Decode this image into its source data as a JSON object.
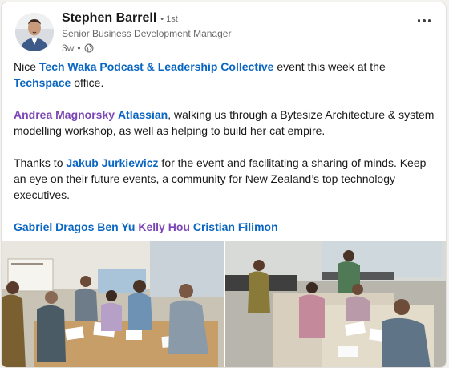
{
  "post": {
    "author": {
      "name": "Stephen Barrell",
      "degree": "• 1st",
      "headline": "Senior Business Development Manager",
      "time": "3w",
      "time_separator": "•",
      "visibility_icon": "globe-icon"
    },
    "menu_icon": "more-horizontal-icon",
    "text": {
      "p1_prefix": "Nice ",
      "p1_link1": "Tech Waka Podcast & Leadership Collective",
      "p1_middle": " event this week at the ",
      "p1_link2": "Techspace",
      "p1_suffix": " office.",
      "p2_mention1": "Andrea Magnorsky",
      "p2_space": " ",
      "p2_link1": "Atlassian",
      "p2_rest": ", walking us through a Bytesize Architecture & system modelling workshop, as well as helping to build her cat empire.",
      "p3_prefix": "Thanks to ",
      "p3_link": "Jakub Jurkiewicz",
      "p3_rest": " for the event and facilitating a sharing of minds. Keep an eye on their future events, a community for New Zealand’s top technology executives.",
      "tag1": "Gabriel Dragos",
      "tag2": "Ben Yu",
      "tag3": "Kelly Hou",
      "tag4": "Cristian Filimon"
    },
    "photos": [
      {
        "alt": "workshop-photo-1"
      },
      {
        "alt": "workshop-photo-2"
      }
    ],
    "colors": {
      "link": "#0a66c2",
      "mention": "#7b46b5",
      "card": "#ffffff",
      "background": "#f3f2ef"
    }
  }
}
